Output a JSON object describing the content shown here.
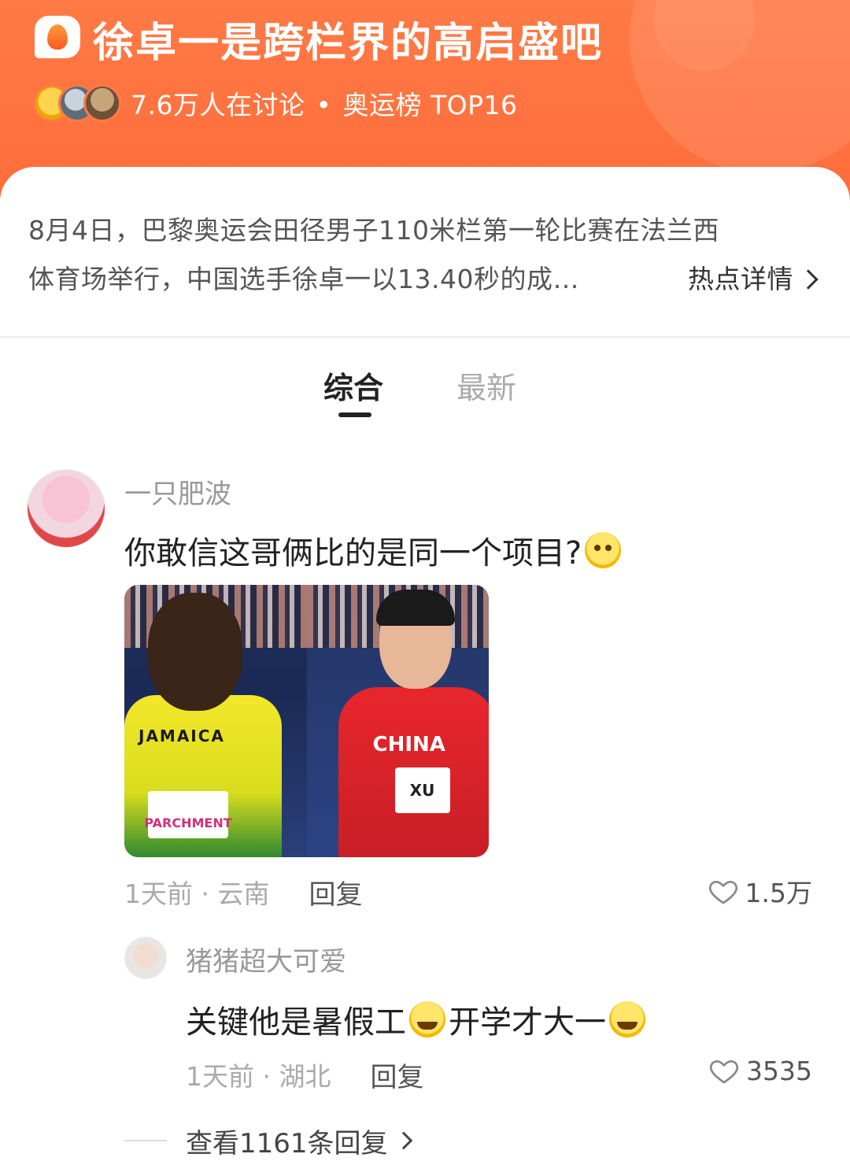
{
  "topic": {
    "title": "徐卓一是跨栏界的高启盛吧",
    "icon": "flame-icon",
    "discussion": "7.6万人在讨论",
    "separator": "•",
    "rank": "奥运榜 TOP16",
    "header_color": "#ff7a45"
  },
  "summary": {
    "line1": "8月4日，巴黎奥运会田径男子110米栏第一轮比赛在法兰西",
    "line2": "体育场举行，中国选手徐卓一以13.40秒的成…",
    "detail_link": "热点详情"
  },
  "tabs": [
    {
      "label": "综合",
      "active": true
    },
    {
      "label": "最新",
      "active": false
    }
  ],
  "comment": {
    "username": "一只肥波",
    "text": "你敢信这哥俩比的是同一个项目?",
    "image": {
      "left_jersey": "JAMAICA",
      "left_bib": "PARCHMENT",
      "right_jersey": "CHINA",
      "right_bib": "XU"
    },
    "time_location": "1天前 · 云南",
    "reply_label": "回复",
    "likes": "1.5万"
  },
  "reply": {
    "username": "猪猪超大可爱",
    "text_part1": "关键他是暑假工",
    "text_part2": "开学才大一",
    "time_location": "1天前 · 湖北",
    "reply_label": "回复",
    "likes": "3535"
  },
  "view_more": "查看1161条回复"
}
